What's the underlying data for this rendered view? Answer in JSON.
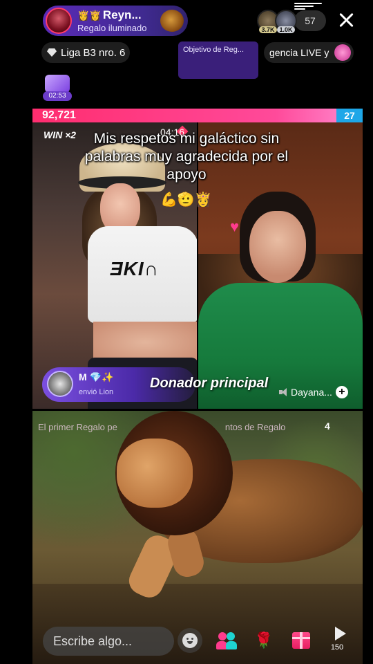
{
  "host": {
    "name": "Reyn...",
    "subtitle": "Regalo iluminado",
    "crowns": "👸👸"
  },
  "viewers": {
    "avatar_badges": [
      "3.7K",
      "1.0K"
    ],
    "count": "57"
  },
  "chips": {
    "league": "Liga B3 nro. 6",
    "goal_card": "Objetivo de Reg...",
    "urgency": "gencia LIVE y"
  },
  "treasure": {
    "timer": "02:53"
  },
  "battle": {
    "left_score": "92,721",
    "right_score": "27",
    "win_tag": "WIN ×2",
    "timer": "04:16"
  },
  "caption": {
    "text": "Mis respetos mi galáctico sin palabras muy agradecida por el apoyo",
    "emoji": "💪🫡👸"
  },
  "donor": {
    "top": "M 💎✨",
    "sub": "envió Lion",
    "title": "Donador principal"
  },
  "partner": {
    "name": "Dayana..."
  },
  "ticker": {
    "left": "El primer Regalo pe",
    "right": "ntos de Regalo",
    "count": "4"
  },
  "bottom": {
    "comment_placeholder": "Escribe algo...",
    "share_count": "150"
  },
  "colors": {
    "battle_left": "#ff2d6f",
    "battle_right": "#1ea7e8",
    "host_pill": "#5b2bb8",
    "donor_badge": "#7b4fe0"
  },
  "icons": [
    "close-icon",
    "diamond-icon",
    "wand-icon",
    "treasure-icon",
    "speaker-icon",
    "plus-icon",
    "smile-icon",
    "multi-guest-icon",
    "rose-icon",
    "gift-icon",
    "share-icon"
  ]
}
